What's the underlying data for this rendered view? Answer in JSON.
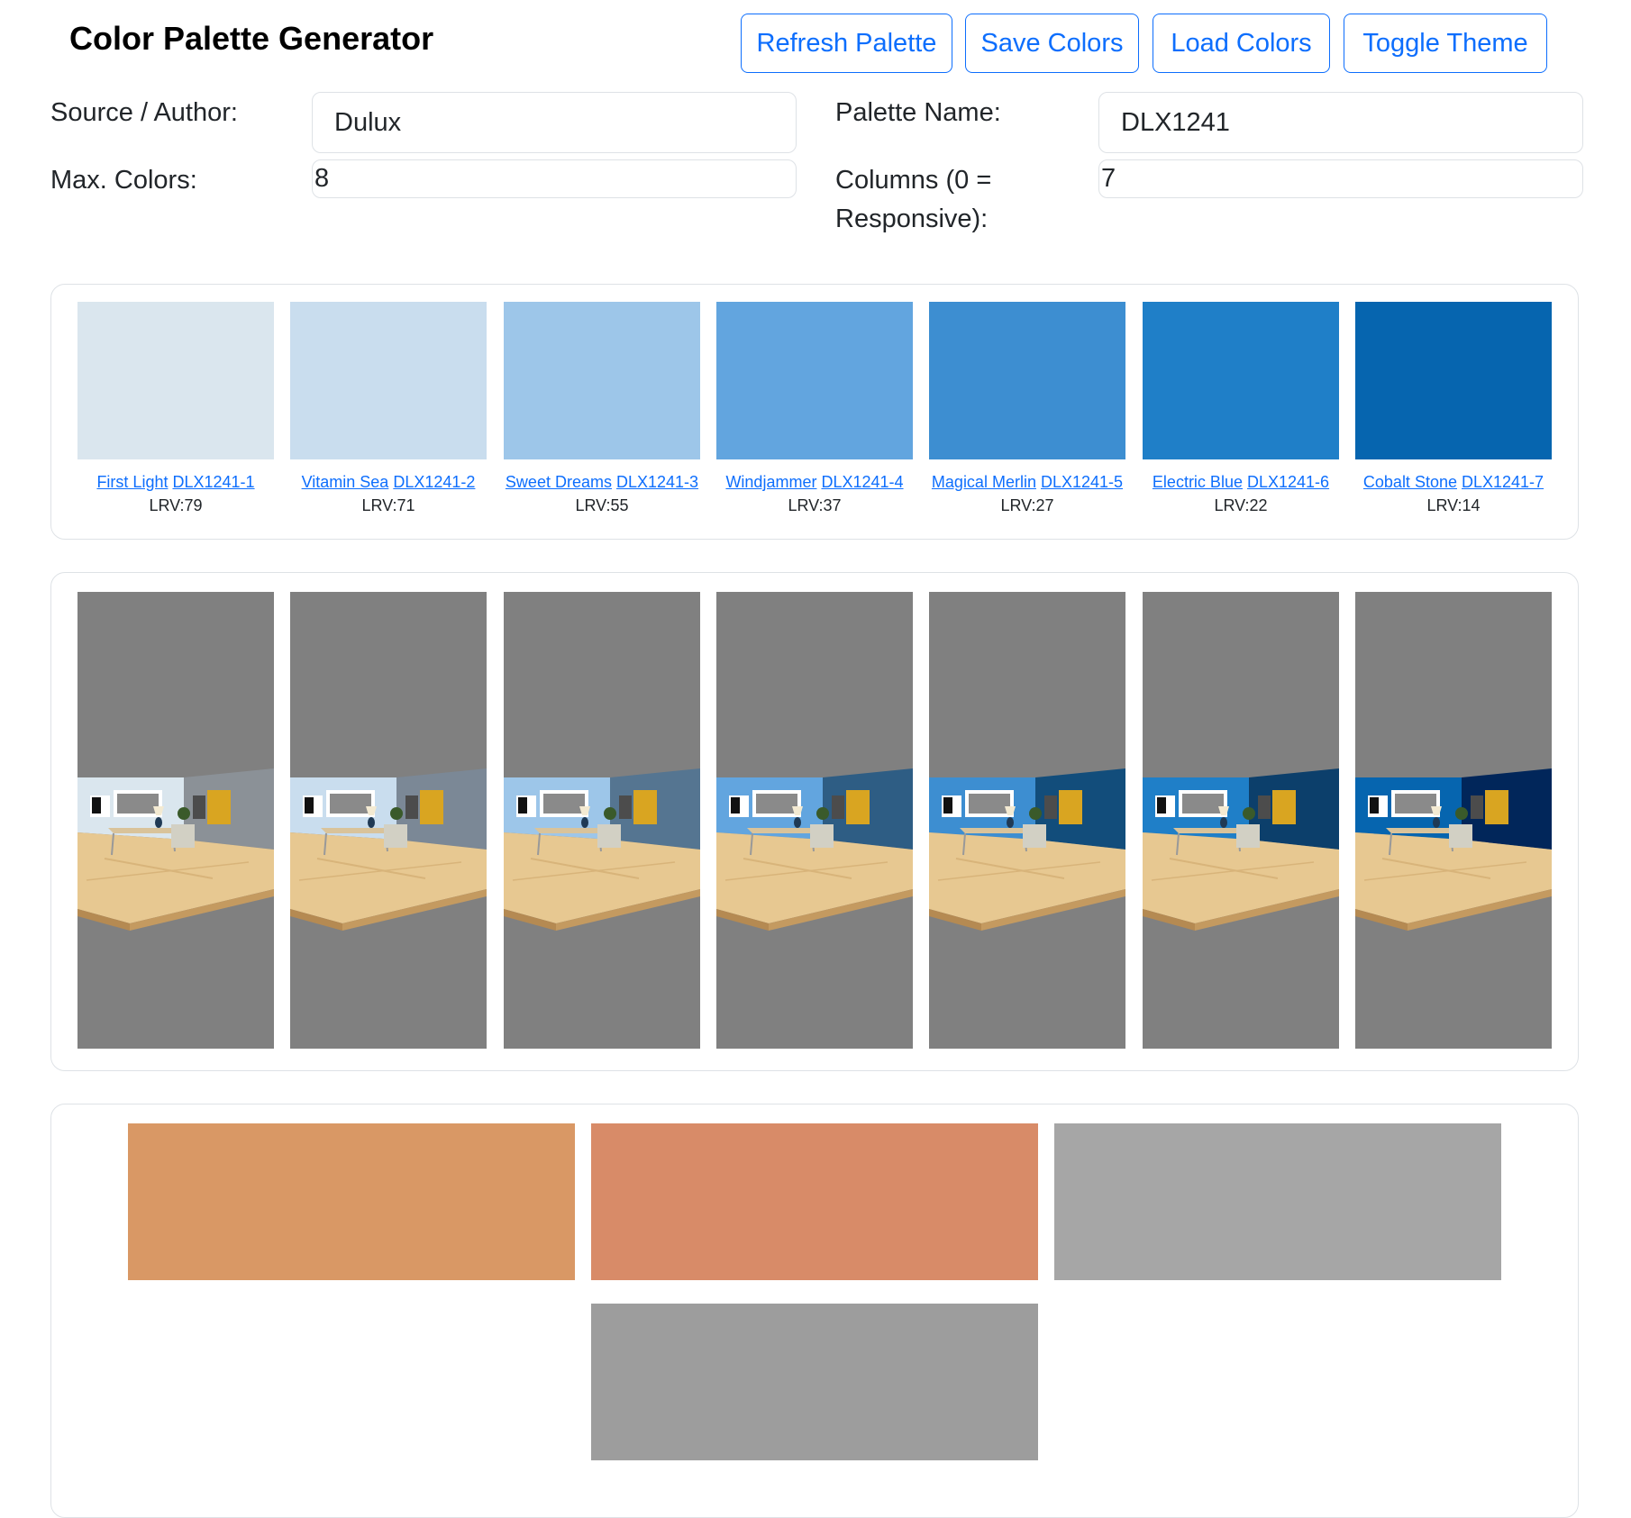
{
  "header": {
    "title": "Color Palette Generator",
    "buttons": {
      "refresh": "Refresh Palette",
      "save": "Save Colors",
      "load": "Load Colors",
      "toggle": "Toggle Theme"
    }
  },
  "form": {
    "source_label": "Source / Author:",
    "source_value": "Dulux",
    "palette_label": "Palette Name:",
    "palette_value": "DLX1241",
    "max_label": "Max. Colors:",
    "max_value": "8",
    "columns_label": "Columns (0 = Responsive):",
    "columns_value": "7"
  },
  "swatches": [
    {
      "name": "First Light",
      "code": "DLX1241-1",
      "lrv": "LRV:79",
      "color": "#dae6ee"
    },
    {
      "name": "Vitamin Sea",
      "code": "DLX1241-2",
      "lrv": "LRV:71",
      "color": "#c9ddee"
    },
    {
      "name": "Sweet Dreams",
      "code": "DLX1241-3",
      "lrv": "LRV:55",
      "color": "#9dc6e9"
    },
    {
      "name": "Windjammer",
      "code": "DLX1241-4",
      "lrv": "LRV:37",
      "color": "#62a5df"
    },
    {
      "name": "Magical Merlin",
      "code": "DLX1241-5",
      "lrv": "LRV:27",
      "color": "#3d8ed1"
    },
    {
      "name": "Electric Blue",
      "code": "DLX1241-6",
      "lrv": "LRV:22",
      "color": "#1f7fc8"
    },
    {
      "name": "Cobalt Stone",
      "code": "DLX1241-7",
      "lrv": "LRV:14",
      "color": "#0665af"
    }
  ],
  "rooms": [
    {
      "wall": "#dae6ee",
      "side": "#8b9197"
    },
    {
      "wall": "#c9ddee",
      "side": "#7b8896"
    },
    {
      "wall": "#9dc6e9",
      "side": "#557591"
    },
    {
      "wall": "#62a5df",
      "side": "#2e5d84"
    },
    {
      "wall": "#3d8ed1",
      "side": "#124d7b"
    },
    {
      "wall": "#1f7fc8",
      "side": "#0c3f6b"
    },
    {
      "wall": "#0665af",
      "side": "#01265a"
    }
  ],
  "accent_colors": [
    "#d99865",
    "#d88b68",
    "#a6a6a6",
    "#9d9d9d"
  ]
}
